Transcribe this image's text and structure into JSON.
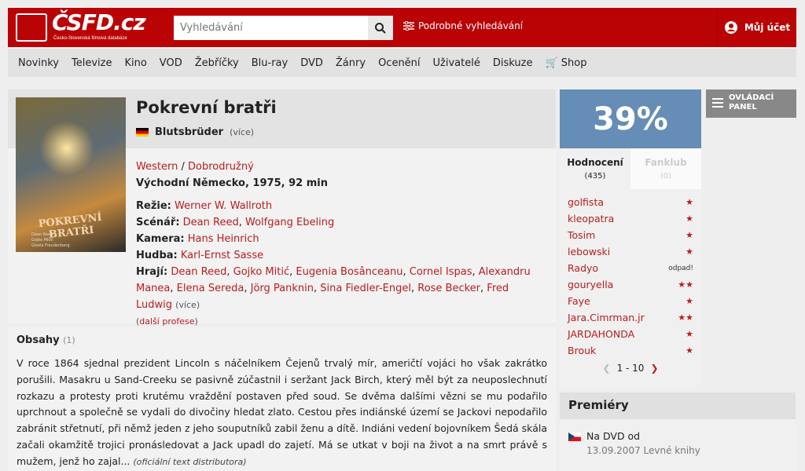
{
  "header": {
    "logo_text": "ČSFD.cz",
    "logo_sub": "Česko-Slovenská filmová databáze",
    "search_placeholder": "Vyhledávání",
    "advanced_search": "Podrobné vyhledávání",
    "account": "Můj účet",
    "brand_color": "#ba0305"
  },
  "nav": [
    "Novinky",
    "Televize",
    "Kino",
    "VOD",
    "Žebříčky",
    "Blu-ray",
    "DVD",
    "Žánry",
    "Ocenění",
    "Uživatelé",
    "Diskuze",
    "Shop"
  ],
  "film": {
    "poster_title": "POKREVNÍ BRATŘI",
    "poster_cast": [
      "Dean Reed",
      "Gojko Mitić",
      "Gisela Freudenberg"
    ],
    "title": "Pokrevní bratři",
    "original_title": "Blutsbrüder",
    "more": "(více)",
    "genres": [
      "Western",
      "Dobrodružný"
    ],
    "genre_sep": " / ",
    "origin": "Východní Německo, 1975, 92 min",
    "director_label": "Režie:",
    "director": "Werner W. Wallroth",
    "writer_label": "Scénář:",
    "writers": [
      "Dean Reed",
      "Wolfgang Ebeling"
    ],
    "camera_label": "Kamera:",
    "camera": "Hans Heinrich",
    "music_label": "Hudba:",
    "music": "Karl-Ernst Sasse",
    "cast_label": "Hrají:",
    "cast": [
      "Dean Reed",
      "Gojko Mitić",
      "Eugenia Bosânceanu",
      "Cornel Ispas",
      "Alexandru Manea",
      "Elena Sereda",
      "Jörg Panknin",
      "Sina Fiedler-Engel",
      "Rose Becker",
      "Fred Ludwig"
    ],
    "more_professions": "další profese"
  },
  "plot": {
    "heading": "Obsahy",
    "count": "(1)",
    "text": "V roce 1864 sjednal prezident Lincoln s náčelníkem Čejenů trvalý mír, američtí vojáci ho však zakrátko porušili. Masakru u Sand-Creeku se pasivně zúčastnil i seržant Jack Birch, který měl být za neuposlechnutí rozkazu a protesty proti krutému vraždění postaven před soud. Se dvěma dalšími vězni se mu podařilo uprchnout a společně se vydali do divočiny hledat zlato. Cestou přes indiánské území se Jackovi nepodařilo zabránit střetnutí, při němž jeden z jeho souputníků zabil ženu a dítě. Indiáni vedení bojovníkem Šedá skála začali okamžitě trojici pronásledovat a Jack upadl do zajetí. Má se utkat v boji na život a na smrt právě s mužem, jenž ho zajal...",
    "source": "(oficiální text distributora)"
  },
  "rating": {
    "percent": "39%",
    "color": "#658db5",
    "tab_ratings": "Hodnocení",
    "tab_ratings_count": "(435)",
    "tab_fanclub": "Fanklub",
    "tab_fanclub_count": "(0)",
    "users": [
      {
        "name": "golfista",
        "stars": "★"
      },
      {
        "name": "kleopatra",
        "stars": "★"
      },
      {
        "name": "Tosim",
        "stars": "★"
      },
      {
        "name": "lebowski",
        "stars": "★"
      },
      {
        "name": "Radyo",
        "stars": "odpad!"
      },
      {
        "name": "gouryella",
        "stars": "★★"
      },
      {
        "name": "Faye",
        "stars": "★"
      },
      {
        "name": "Jara.Cimrman.jr",
        "stars": "★★"
      },
      {
        "name": "JARDAHONDA",
        "stars": "★"
      },
      {
        "name": "Brouk",
        "stars": "★"
      }
    ],
    "pager": "1 - 10"
  },
  "premieres": {
    "heading": "Premiéry",
    "item": "Na DVD od",
    "detail": "13.09.2007 Levné knihy"
  },
  "control_panel": "OVLÁDACÍ PANEL"
}
